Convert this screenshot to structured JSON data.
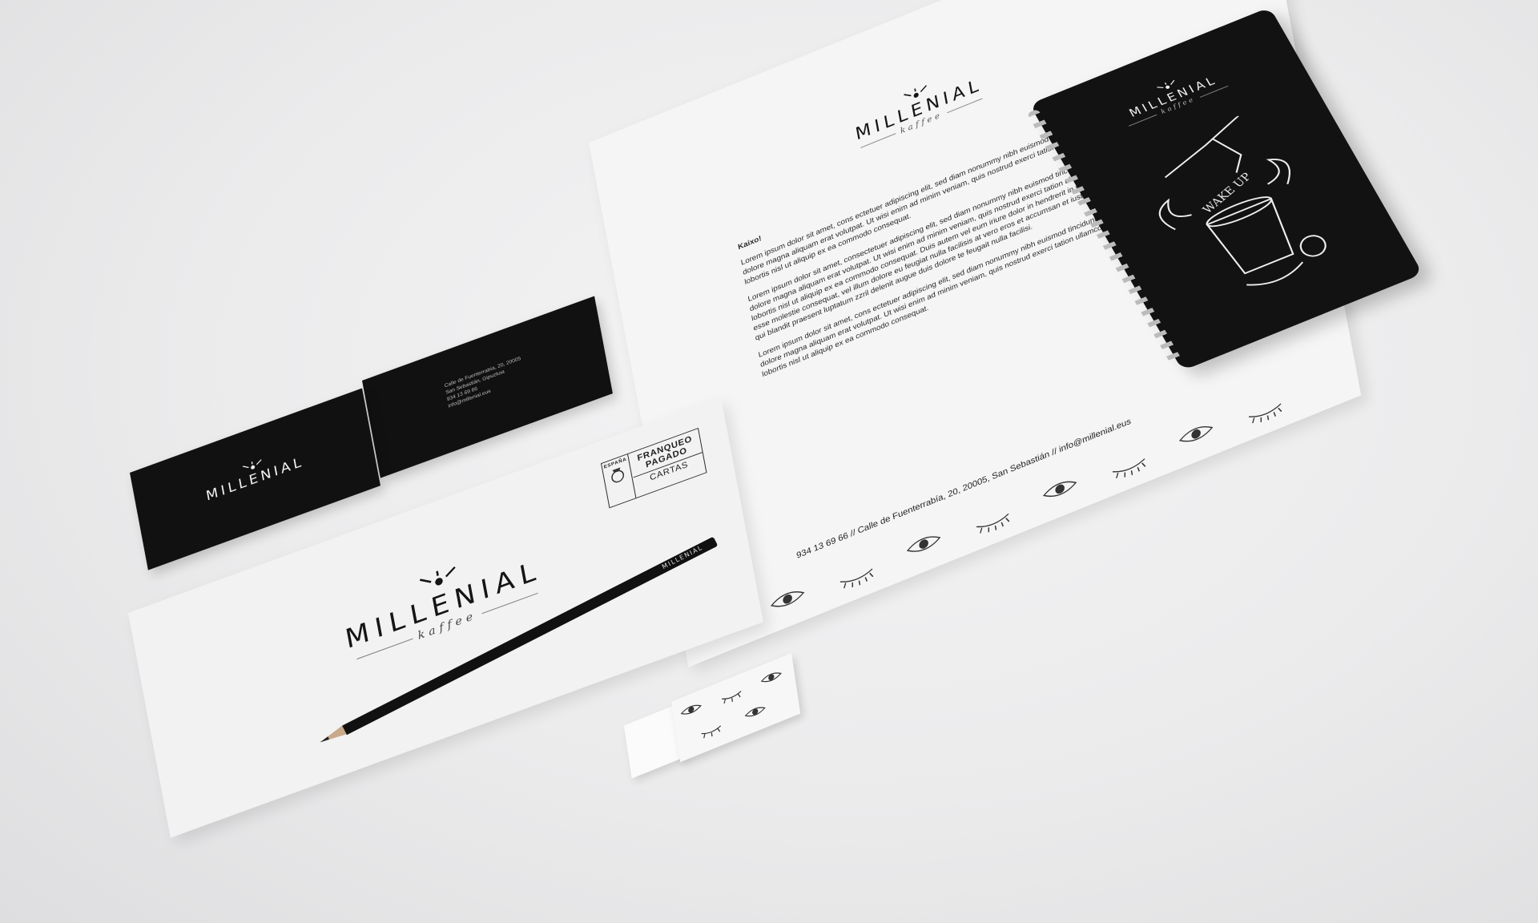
{
  "brand": {
    "name": "MILLENIAL",
    "tagline": "kaffee",
    "colors": {
      "ink": "#111111",
      "paper": "#f5f5f6",
      "accent": "#8a7fa6",
      "background": "#e9e9ea"
    }
  },
  "letterhead": {
    "greeting": "Kaixo!",
    "body_paragraphs": [
      "Lorem ipsum dolor sit amet, cons ectetuer adipiscing elit, sed diam nonummy nibh euismod tincidunt ut laoreet dolore magna aliquam erat volutpat. Ut wisi enim ad minim veniam, quis nostrud exerci tation ullamcorper suscipit lobortis nisl ut aliquip ex ea commodo consequat.",
      "Lorem ipsum dolor sit amet, consectetuer adipiscing elit, sed diam nonummy nibh euismod tincidunt ut laoreet dolore magna aliquam erat volutpat. Ut wisi enim ad minim veniam, quis nostrud exerci tation ullamcorper suscipit lobortis nisl ut aliquip ex ea commodo consequat. Duis autem vel eum iriure dolor in hendrerit in vulputate velit esse molestie consequat, vel illum dolore eu feugiat nulla facilisis at vero eros et accumsan et iusto odio dignissim qui blandit praesent luptatum zzril delenit augue duis dolore te feugait nulla facilisi.",
      "Lorem ipsum dolor sit amet, cons ectetuer adipiscing elit, sed diam nonummy nibh euismod tincidunt ut laoreet dolore magna aliquam erat volutpat. Ut wisi enim ad minim veniam, quis nostrud exerci tation ullamcorper suscipit lobortis nisl ut aliquip ex ea commodo consequat."
    ],
    "footer_contact": "934 13 69 66 // Calle de Fuenterrabía, 20, 20005, San Sebastián // info@millenial.eus"
  },
  "envelope": {
    "stamp": {
      "country": "ESPAÑA",
      "line1": "FRANQUEO",
      "line2": "PAGADO",
      "line3": "CARTAS"
    }
  },
  "business_card_back": {
    "lines": [
      "Calle de Fuenterrabía, 20, 20005",
      "San Sebastián, Gipuzkoa",
      "934 13 69 66",
      "info@millenial.eus"
    ]
  },
  "pencil": {
    "label": "MILLENIAL"
  },
  "notebook": {
    "illustration_text": "WAKE UP"
  }
}
